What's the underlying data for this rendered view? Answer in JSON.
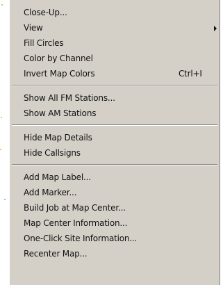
{
  "menu": {
    "groups": [
      {
        "items": [
          {
            "label": "Close-Up..."
          },
          {
            "label": "View"
          },
          {
            "label": "Fill Circles"
          },
          {
            "label": "Color by Channel"
          },
          {
            "label": "Invert Map Colors",
            "shortcut": "Ctrl+I"
          }
        ]
      },
      {
        "items": [
          {
            "label": "Show All FM Stations..."
          },
          {
            "label": "Show AM Stations"
          }
        ]
      },
      {
        "items": [
          {
            "label": "Hide Map Details"
          },
          {
            "label": "Hide Callsigns"
          }
        ]
      },
      {
        "items": [
          {
            "label": "Add Map Label..."
          },
          {
            "label": "Add Marker..."
          },
          {
            "label": "Build Job at Map Center..."
          },
          {
            "label": "Map Center Information..."
          },
          {
            "label": "One-Click Site Information..."
          },
          {
            "label": "Recenter Map..."
          }
        ]
      }
    ]
  }
}
